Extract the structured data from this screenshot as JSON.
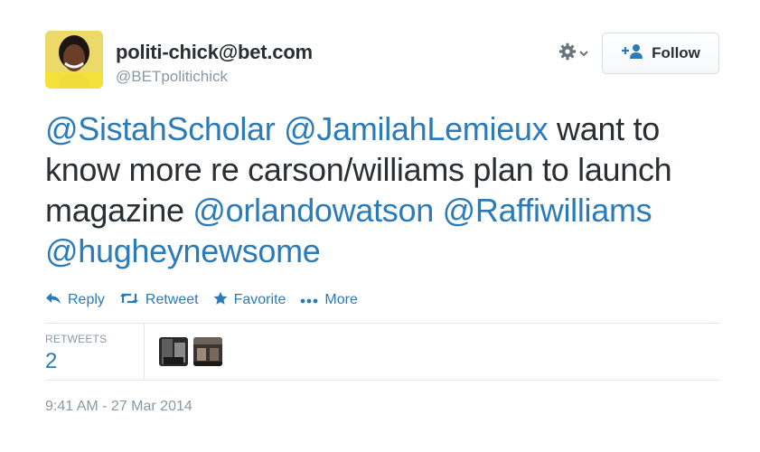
{
  "tweet": {
    "user": {
      "fullname": "politi-chick@bet.com",
      "screen_name": "@BETpolitichick"
    },
    "follow_label": "Follow",
    "text": {
      "line1": {
        "m1": "@SistahScholar",
        "m2": "@JamilahLemieux",
        "t1": " want to"
      },
      "line2": {
        "t1": "know more re carson/williams plan to launch"
      },
      "line3": {
        "t1": "magazine ",
        "m1": "@orlandowatson",
        "m2": "@Raffiwilliams"
      },
      "line4": {
        "m1": "@hugheynewsome"
      }
    },
    "actions": {
      "reply": "Reply",
      "retweet": "Retweet",
      "favorite": "Favorite",
      "more": "More"
    },
    "stats": {
      "retweets_label": "RETWEETS",
      "retweets_count": "2"
    },
    "timestamp": "9:41 AM - 27 Mar 2014"
  },
  "colors": {
    "link": "#2b7bb9",
    "text": "#292f33",
    "muted": "#8899a6",
    "border": "#e1e8ed"
  }
}
